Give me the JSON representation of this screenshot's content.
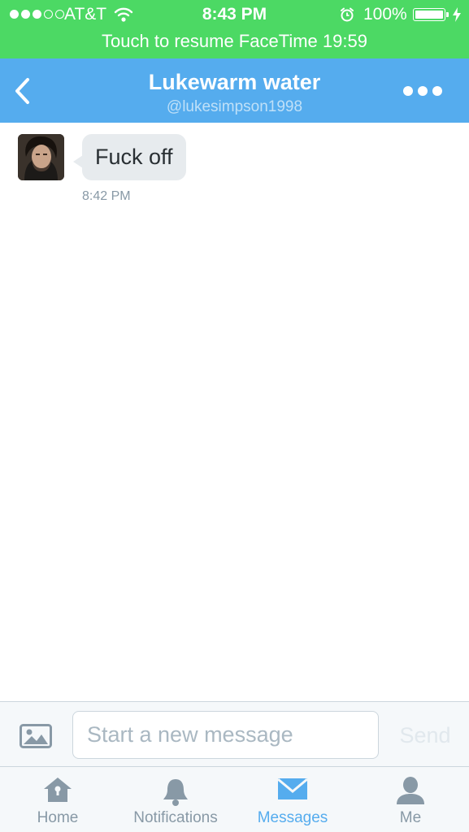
{
  "status_bar": {
    "signal": [
      "full",
      "full",
      "full",
      "empty",
      "empty"
    ],
    "carrier": "AT&T",
    "time": "8:43 PM",
    "battery": "100%",
    "banner": "Touch to resume FaceTime 19:59"
  },
  "header": {
    "title": "Lukewarm water",
    "handle": "@lukesimpson1998"
  },
  "conversation": {
    "messages": [
      {
        "text": "Fuck off",
        "time": "8:42 PM"
      }
    ]
  },
  "composer": {
    "placeholder": "Start a new message",
    "value": "",
    "send_label": "Send"
  },
  "tabs": [
    {
      "label": "Home",
      "icon": "home-icon",
      "active": false
    },
    {
      "label": "Notifications",
      "icon": "bell-icon",
      "active": false
    },
    {
      "label": "Messages",
      "icon": "envelope-icon",
      "active": true
    },
    {
      "label": "Me",
      "icon": "person-icon",
      "active": false
    }
  ],
  "colors": {
    "status_green": "#4cd964",
    "twitter_blue": "#55acee",
    "bubble_gray": "#e7ebee",
    "muted_text": "#8899a6"
  }
}
